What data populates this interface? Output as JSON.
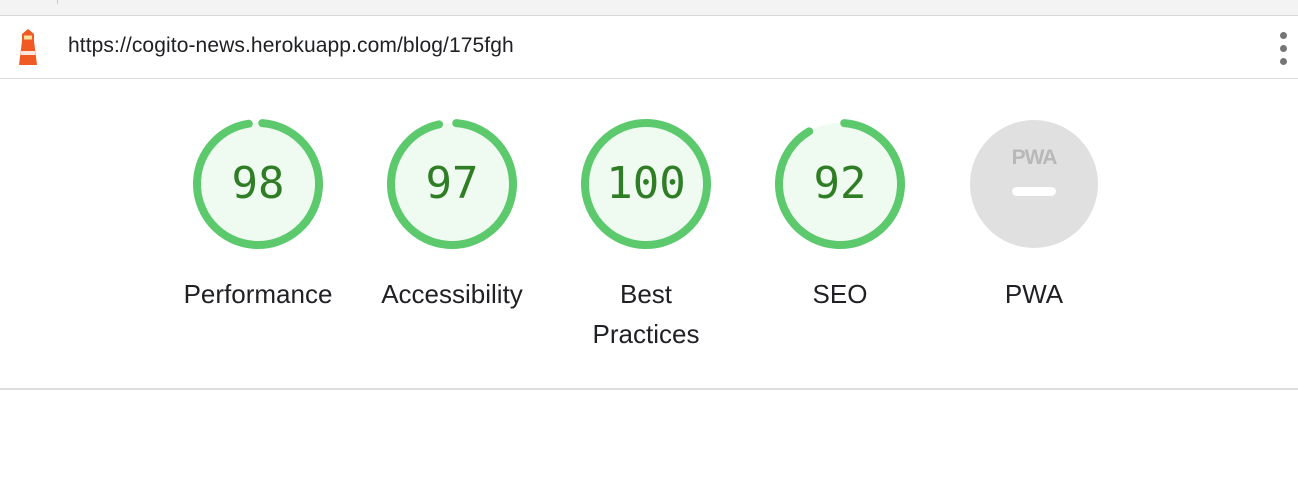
{
  "url_bar": {
    "url": "https://cogito-news.herokuapp.com/blog/175fgh",
    "app_icon": "lighthouse-icon",
    "menu_icon": "kebab-menu-icon"
  },
  "colors": {
    "pass_ring": "#5cc96d",
    "pass_fill": "#effaf1",
    "pass_text": "#2f7d24",
    "pwa_bg": "#e0e0e0",
    "pwa_mark": "#ffffff"
  },
  "gauges": [
    {
      "score": "98",
      "value": 98,
      "label": "Performance"
    },
    {
      "score": "97",
      "value": 97,
      "label": "Accessibility"
    },
    {
      "score": "100",
      "value": 100,
      "label": "Best\nPractices"
    },
    {
      "score": "92",
      "value": 92,
      "label": "SEO"
    },
    {
      "label": "PWA",
      "badge_text": "PWA",
      "badge_icon": "pwa-badge-icon"
    }
  ]
}
